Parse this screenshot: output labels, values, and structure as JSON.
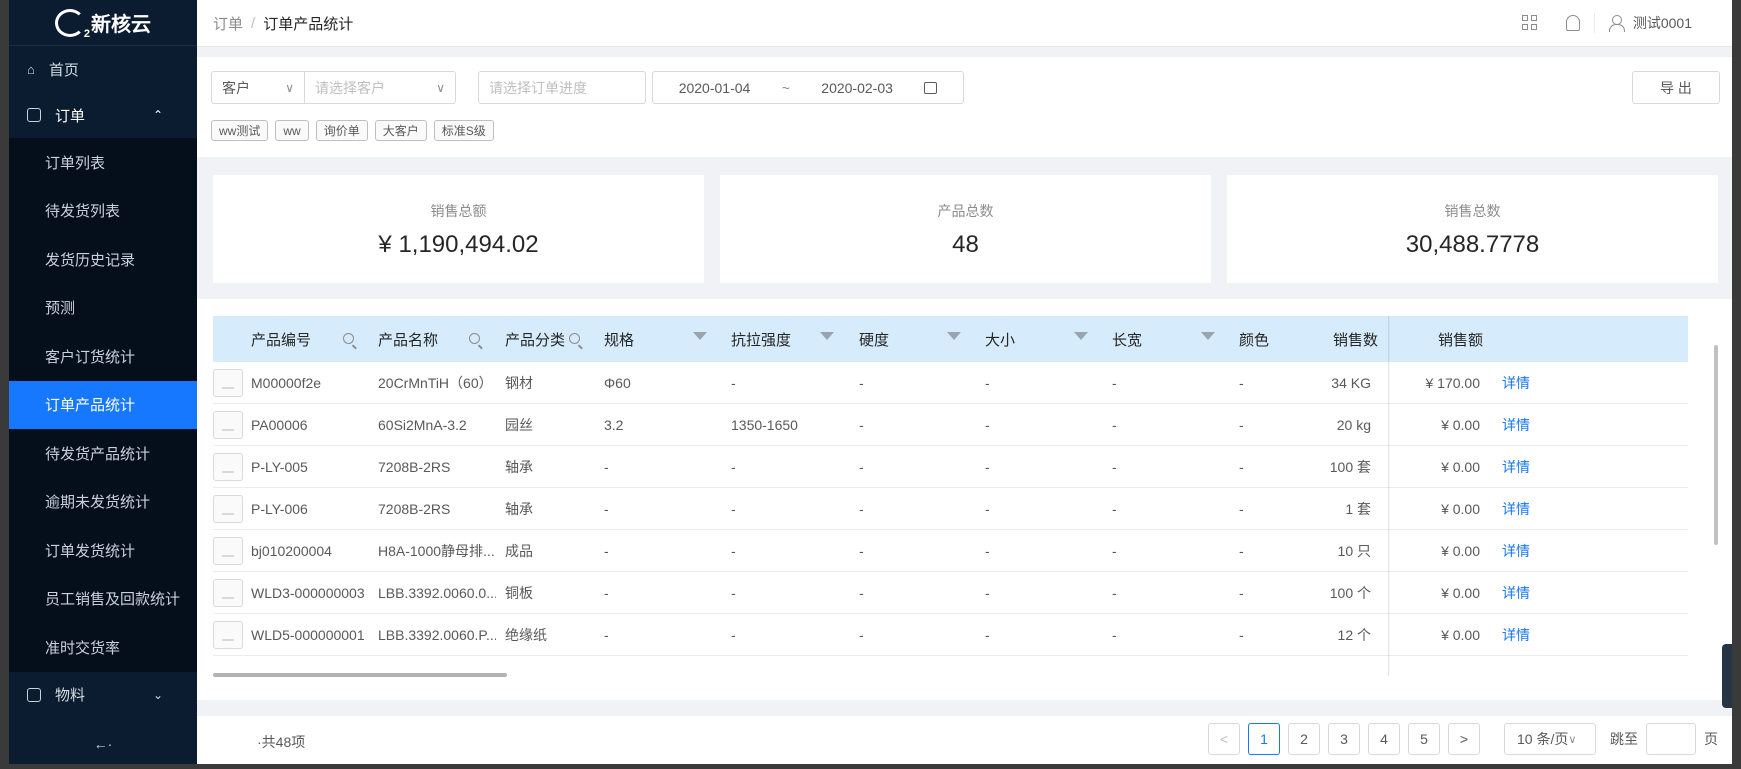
{
  "app": {
    "logo_text": "新核云",
    "logo_sub": "2"
  },
  "sidebar": {
    "home": "首页",
    "orders": "订单",
    "order_items": [
      "订单列表",
      "待发货列表",
      "发货历史记录",
      "预测",
      "客户订货统计",
      "订单产品统计",
      "待发货产品统计",
      "逾期未发货统计",
      "订单发货统计",
      "员工销售及回款统计",
      "准时交货率"
    ],
    "active_index": 5,
    "materials": "物料",
    "collapse": "←·"
  },
  "header": {
    "breadcrumb_root": "订单",
    "breadcrumb_sep": "/",
    "breadcrumb_current": "订单产品统计",
    "user": "测试0001"
  },
  "filters": {
    "type_select": "客户",
    "customer_placeholder": "请选择客户",
    "progress_placeholder": "请选择订单进度",
    "date_start": "2020-01-04",
    "date_sep": "~",
    "date_end": "2020-02-03",
    "export_label": "导 出",
    "tags": [
      "ww测试",
      "ww",
      "询价单",
      "大客户",
      "标准S级"
    ]
  },
  "stats": [
    {
      "label": "销售总额",
      "value": "¥ 1,190,494.02"
    },
    {
      "label": "产品总数",
      "value": "48"
    },
    {
      "label": "销售总数",
      "value": "30,488.7778"
    }
  ],
  "table": {
    "columns": [
      "产品编号",
      "产品名称",
      "产品分类",
      "规格",
      "抗拉强度",
      "硬度",
      "大小",
      "长宽",
      "颜色",
      "销售数",
      "销售额"
    ],
    "detail_label": "详情",
    "rows": [
      [
        "M00000f2e",
        "20CrMnTiH（60）",
        "钢材",
        "Φ60",
        "-",
        "-",
        "-",
        "-",
        "-",
        "34 KG",
        "¥ 170.00"
      ],
      [
        "PA00006",
        "60Si2MnA-3.2",
        "园丝",
        "3.2",
        "1350-1650",
        "-",
        "-",
        "-",
        "-",
        "20 kg",
        "¥ 0.00"
      ],
      [
        "P-LY-005",
        "7208B-2RS",
        "轴承",
        "-",
        "-",
        "-",
        "-",
        "-",
        "-",
        "100 套",
        "¥ 0.00"
      ],
      [
        "P-LY-006",
        "7208B-2RS",
        "轴承",
        "-",
        "-",
        "-",
        "-",
        "-",
        "-",
        "1 套",
        "¥ 0.00"
      ],
      [
        "bj010200004",
        "H8A-1000静母排...",
        "成品",
        "-",
        "-",
        "-",
        "-",
        "-",
        "-",
        "10 只",
        "¥ 0.00"
      ],
      [
        "WLD3-000000003",
        "LBB.3392.0060.0...",
        "铜板",
        "-",
        "-",
        "-",
        "-",
        "-",
        "-",
        "100 个",
        "¥ 0.00"
      ],
      [
        "WLD5-000000001",
        "LBB.3392.0060.P...",
        "绝缘纸",
        "-",
        "-",
        "-",
        "-",
        "-",
        "-",
        "12 个",
        "¥ 0.00"
      ]
    ]
  },
  "pagination": {
    "total": "·共48项",
    "pages": [
      "1",
      "2",
      "3",
      "4",
      "5"
    ],
    "current": "1",
    "prev": "<",
    "next": ">",
    "page_size": "10 条/页",
    "jump_label": "跳至",
    "page_suffix": "页"
  }
}
